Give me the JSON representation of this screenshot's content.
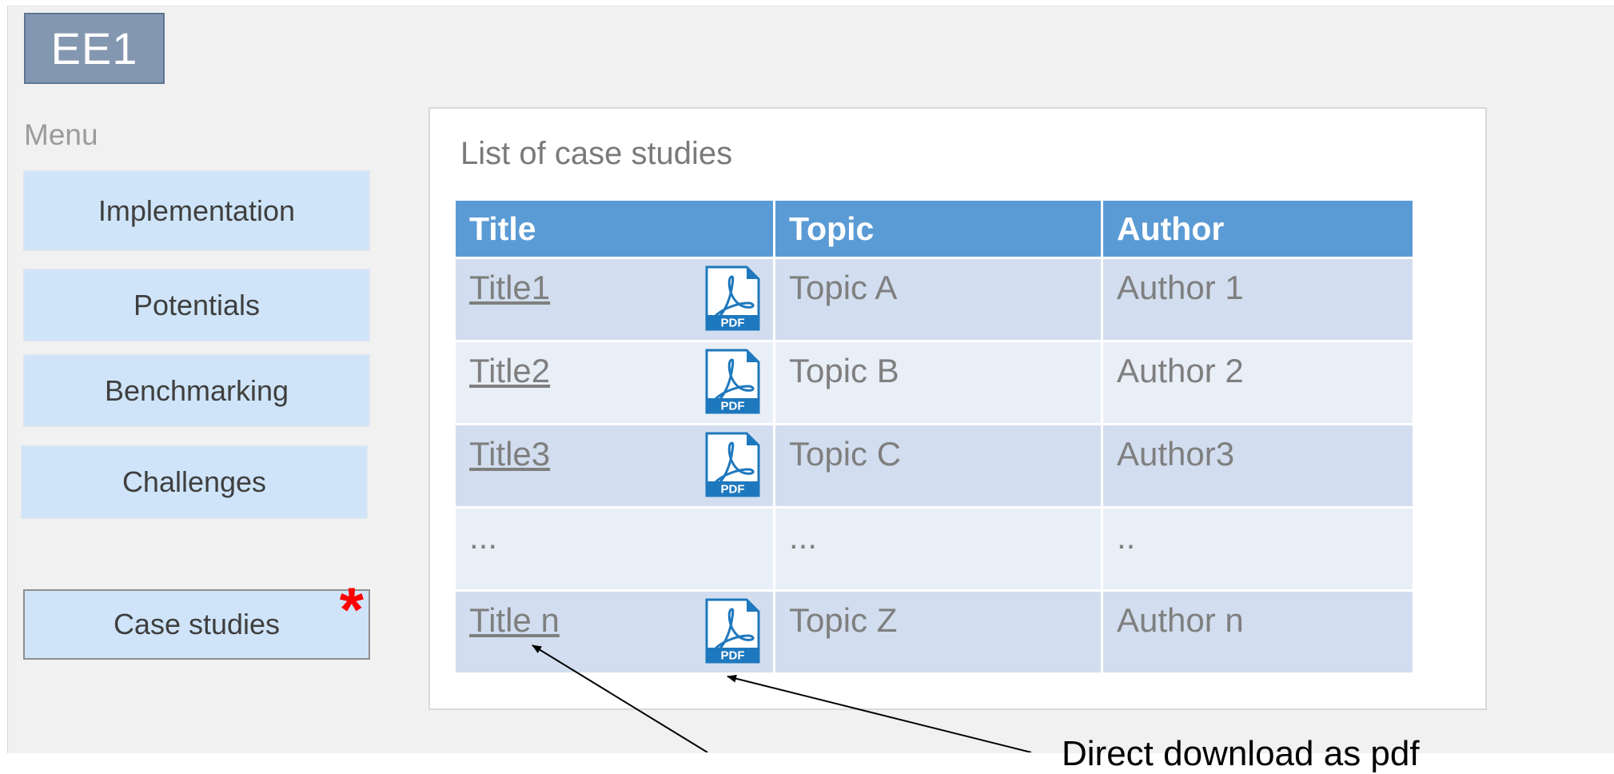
{
  "logo": {
    "text": "EE1"
  },
  "menu": {
    "title": "Menu",
    "items": [
      {
        "label": "Implementation"
      },
      {
        "label": "Potentials"
      },
      {
        "label": "Benchmarking"
      },
      {
        "label": "Challenges"
      }
    ],
    "selected_item": {
      "label": "Case studies",
      "marker": "*"
    }
  },
  "case_studies": {
    "title": "List of case studies",
    "columns": [
      "Title",
      "Topic",
      "Author"
    ],
    "rows": [
      {
        "title": "Title1",
        "topic": "Topic A",
        "author": "Author 1",
        "has_pdf": true
      },
      {
        "title": "Title2",
        "topic": "Topic B",
        "author": "Author 2",
        "has_pdf": true
      },
      {
        "title": "Title3",
        "topic": "Topic C",
        "author": "Author3",
        "has_pdf": true
      },
      {
        "title": "...",
        "topic": "...",
        "author": "..",
        "has_pdf": false
      },
      {
        "title": "Title n",
        "topic": "Topic Z",
        "author": "Author n",
        "has_pdf": true
      }
    ],
    "pdf_icon_label": "PDF"
  },
  "annotation": {
    "text": "Direct download as pdf"
  },
  "colors": {
    "header_bg": "#5b9bd5",
    "row_odd": "#d2deef",
    "row_even": "#e9eff7",
    "menu_button": "#cfe4f8",
    "logo_bg": "#8497b0",
    "asterisk": "#ff0000",
    "pdf_blue": "#1e78be"
  }
}
